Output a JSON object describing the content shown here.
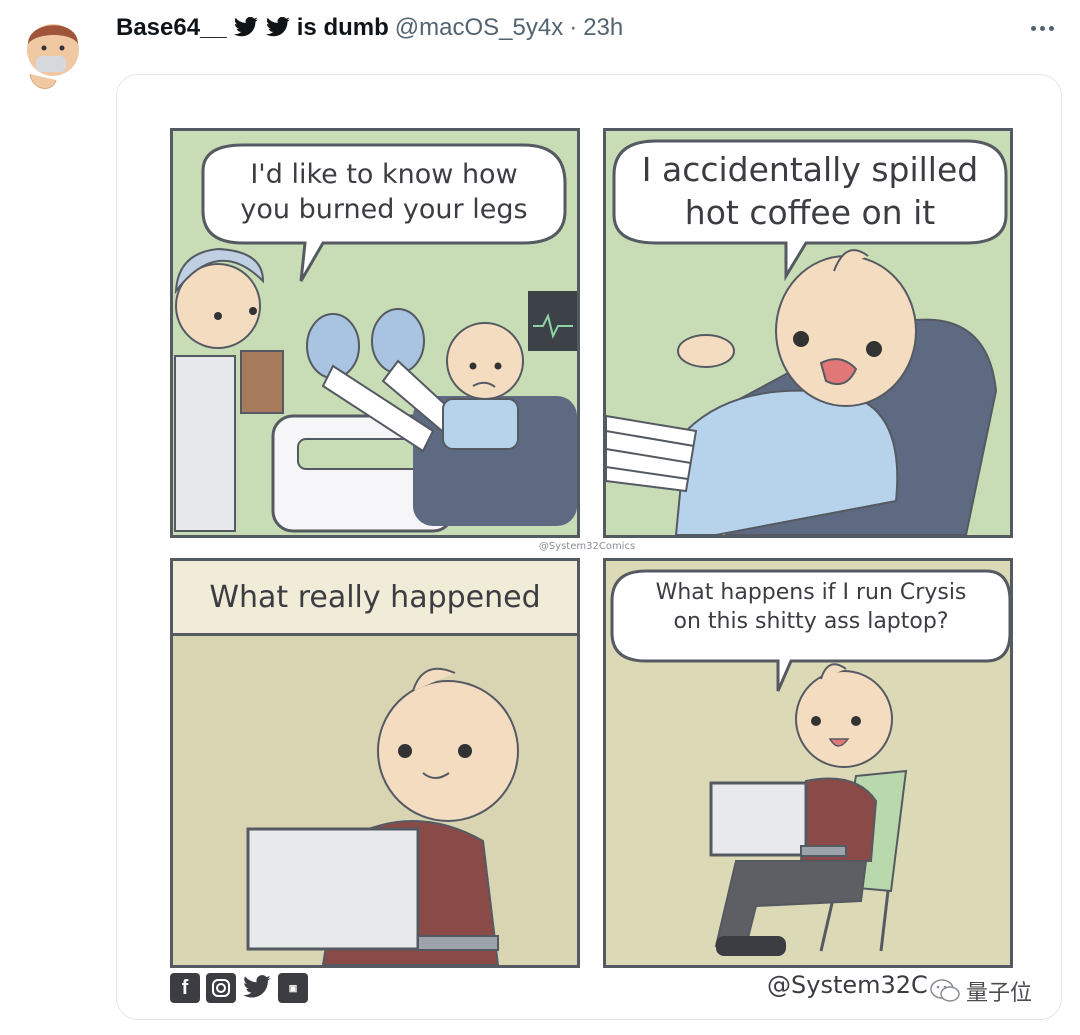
{
  "tweet": {
    "display_name": "Base64__",
    "name_suffix": "is dumb",
    "handle": "@macOS_5y4x",
    "separator": "·",
    "time": "23h"
  },
  "comic": {
    "panel1_bubble": [
      "I'd like to know how",
      "you burned your legs"
    ],
    "panel2_bubble": [
      "I accidentally spilled",
      "hot coffee on it"
    ],
    "panel3_caption": "What really happened",
    "panel4_bubble": [
      "What happens if I run Crysis",
      "on this shitty ass laptop?"
    ],
    "credit_small": "@System32Comics",
    "credit_big": "@System32C",
    "social_icons": [
      "facebook-icon",
      "instagram-icon",
      "twitter-icon",
      "webtoon-icon"
    ]
  },
  "watermark": {
    "text": "量子位",
    "icon": "wechat-icon"
  },
  "colors": {
    "panel_green": "#c8dcb6",
    "panel_tan": "#d9d5b2",
    "outline": "#555a62",
    "twitter_text": "#0f1419",
    "secondary_text": "#536471"
  }
}
